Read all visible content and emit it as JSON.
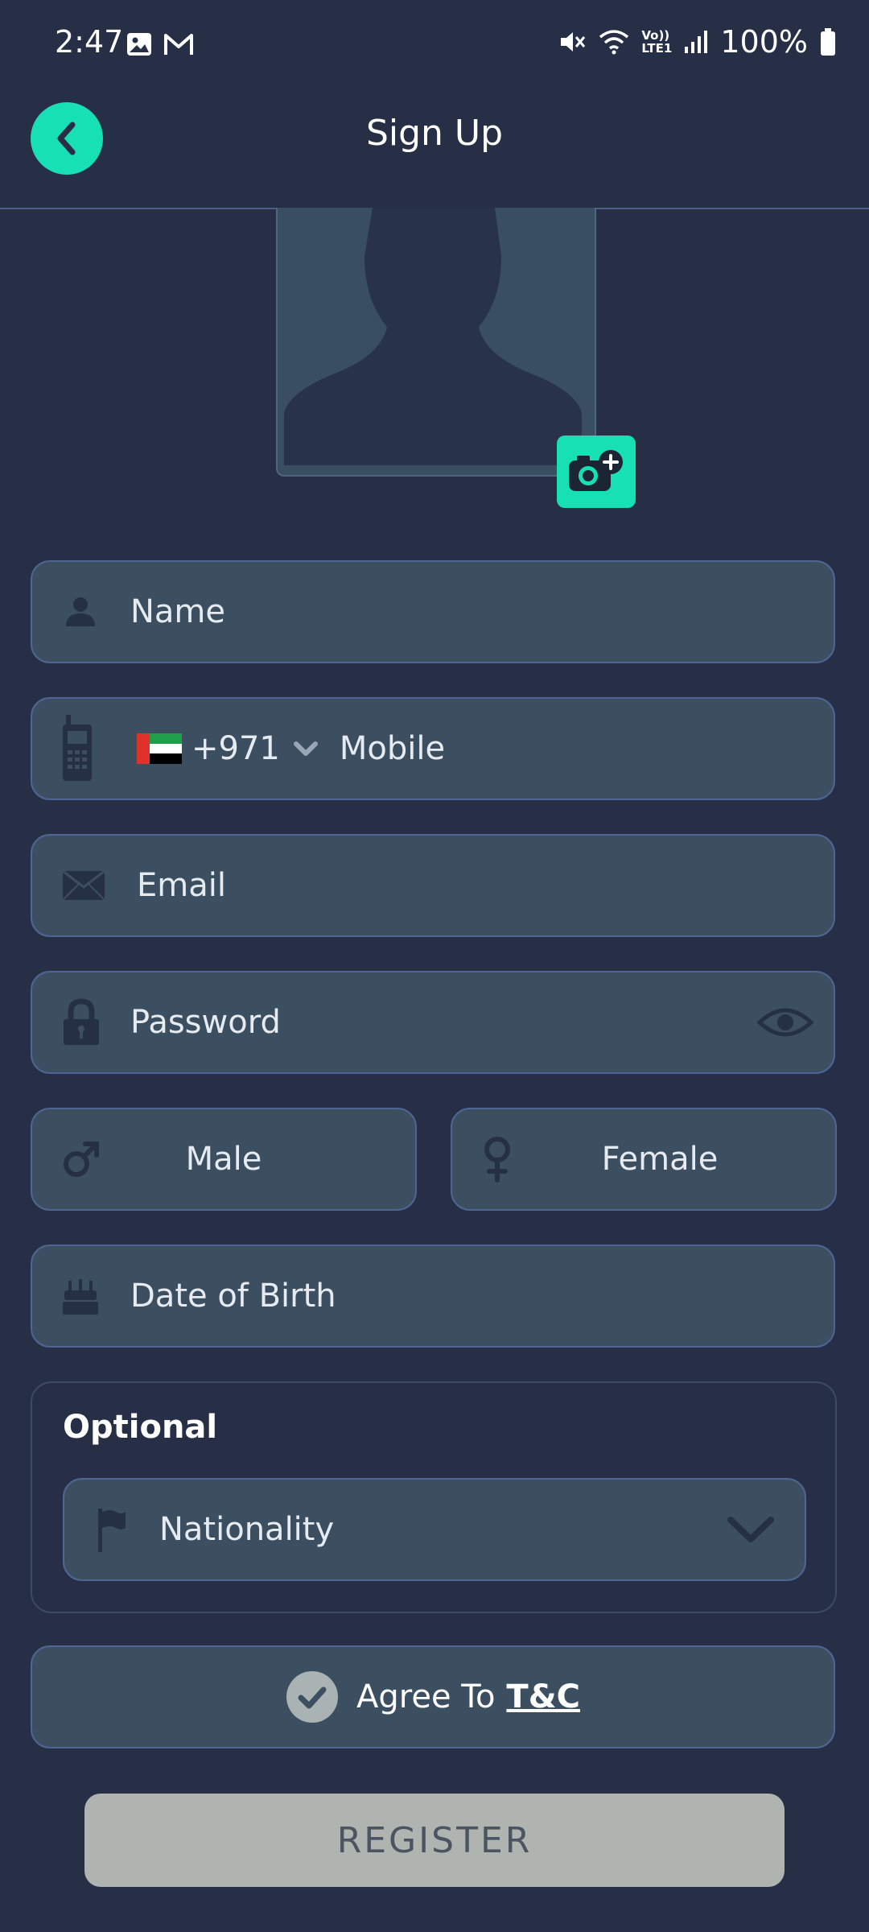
{
  "status_bar": {
    "time": "2:47",
    "battery": "100%",
    "network_label_top": "Vo))",
    "network_label_bottom": "LTE1"
  },
  "header": {
    "title": "Sign Up"
  },
  "form": {
    "name_placeholder": "Name",
    "country_code": "+971",
    "mobile_placeholder": "Mobile",
    "email_placeholder": "Email",
    "password_placeholder": "Password",
    "gender_male": "Male",
    "gender_female": "Female",
    "dob_placeholder": "Date of Birth"
  },
  "optional": {
    "title": "Optional",
    "nationality_placeholder": "Nationality"
  },
  "agree": {
    "prefix": "Agree To",
    "link": "T&C"
  },
  "register_label": "REGISTER",
  "colors": {
    "background": "#272f47",
    "accent": "#17e1b4",
    "field_bg": "#3c4f60",
    "field_border": "#4f6593",
    "register_bg": "#afb4b1"
  },
  "icons": [
    "back-arrow-icon",
    "camera-plus-icon",
    "person-icon",
    "phone-icon",
    "uae-flag-icon",
    "chevron-down-icon",
    "envelope-icon",
    "lock-icon",
    "eye-icon",
    "male-icon",
    "female-icon",
    "cake-icon",
    "flag-icon",
    "check-circle-icon"
  ]
}
